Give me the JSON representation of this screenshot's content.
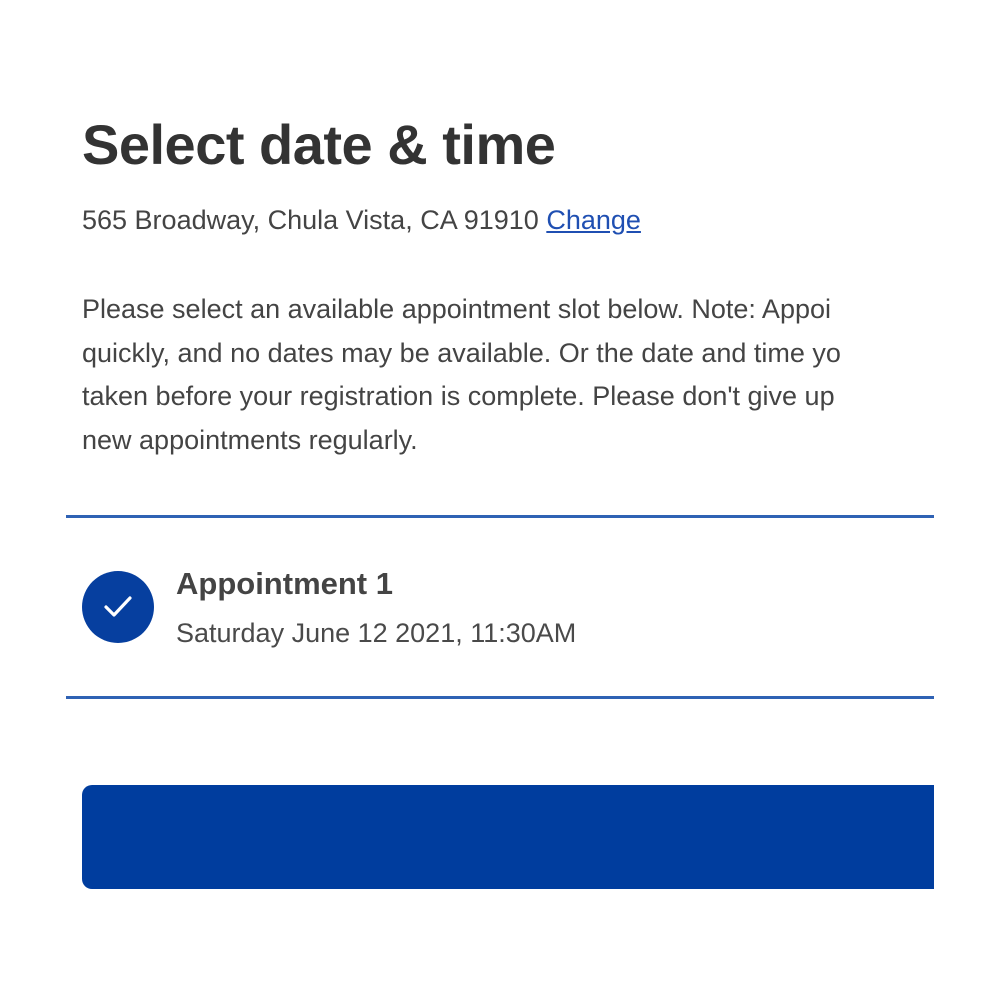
{
  "page": {
    "title": "Select date & time"
  },
  "location": {
    "address": "565 Broadway, Chula Vista, CA 91910",
    "change_label": "Change"
  },
  "notice": {
    "lines": [
      "Please select an available appointment slot below. Note: Appoi",
      "quickly, and no dates may be available. Or the date and time yo",
      "taken before your registration is complete. Please don't give up",
      "new appointments regularly."
    ]
  },
  "appointment": {
    "status_icon": "check-icon",
    "title": "Appointment 1",
    "datetime": "Saturday June 12 2021, 11:30AM"
  },
  "colors": {
    "accent": "#003d9e",
    "link": "#1f4fb2",
    "divider": "#2f62b4",
    "text": "#444444",
    "heading": "#333333"
  }
}
